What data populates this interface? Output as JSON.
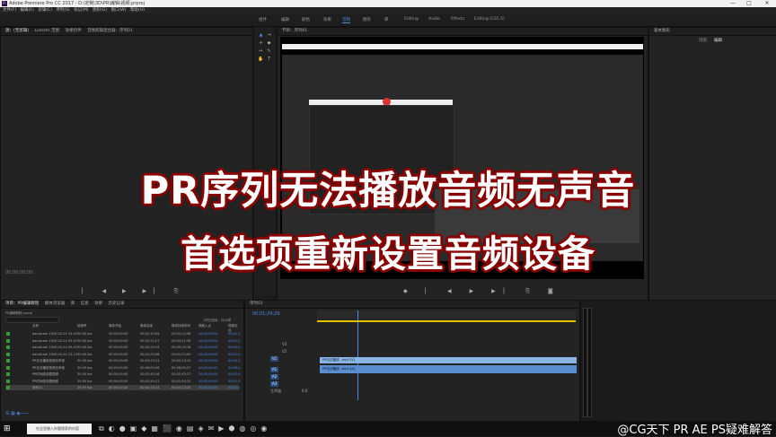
{
  "titlebar": {
    "title": "Adobe Premiere Pro CC 2017 - D:\\定制\\3D\\PR\\编辑\\视频.prproj",
    "min": "—",
    "max": "□",
    "close": "✕"
  },
  "menubar": [
    "文件(F)",
    "编辑(E)",
    "剪辑(C)",
    "序列(S)",
    "标记(M)",
    "图形(G)",
    "窗口(W)",
    "帮助(H)"
  ],
  "workspaces": [
    "组件",
    "编辑",
    "颜色",
    "效果",
    "音频",
    "图形",
    "库",
    "Editing",
    "Audio",
    "Effects",
    "Editing (CS5.5)"
  ],
  "active_workspace": "音频",
  "source_panel": {
    "tabs": [
      "源：(无剪辑)",
      "Lumetri 范围",
      "效果控件",
      "音频剪辑混合器：序列01"
    ],
    "timecode": "00;00;00;00"
  },
  "program_panel": {
    "title": "节目：序列01",
    "inner_title": "节目：序列01"
  },
  "right_panel": {
    "title": "基本图形",
    "tabs": [
      "浏览",
      "编辑"
    ]
  },
  "project_panel": {
    "tabs": [
      "项目：PR编辑教程",
      "媒体浏览器",
      "库",
      "信息",
      "效果",
      "历史记录"
    ],
    "path": "PR编辑教程.prproj",
    "item_count": "1项已选择，共28项",
    "columns": [
      "名称",
      "帧速率",
      "媒体开始",
      "媒体结束",
      "媒体持续时间",
      "视频入点",
      "视频出点"
    ],
    "rows": [
      {
        "name": "bandicam 2020-04-21 15-43",
        "fps": "30.00 fps",
        "start": "00;00;00;00",
        "end": "00;01;10;05",
        "dur": "00;01;10;06",
        "in": "00;00;00;00",
        "out": "00;01;1"
      },
      {
        "name": "bandicam 2020-04-24 09-41",
        "fps": "30.00 fps",
        "start": "00;00;00;00",
        "end": "00;02;21;27",
        "dur": "00;02;21;28",
        "in": "00;00;00;00",
        "out": "00;02;2"
      },
      {
        "name": "bandicam 2020-04-24 09-45",
        "fps": "30.00 fps",
        "start": "00;00;00;00",
        "end": "00;00;29;15",
        "dur": "00;00;29;16",
        "in": "00;00;00;00",
        "out": "00;00;2"
      },
      {
        "name": "bandicam 2020-04-24 13-14",
        "fps": "30.00 fps",
        "start": "00;00;00;00",
        "end": "00;01;23;08",
        "dur": "00;01;23;09",
        "in": "00;00;00;00",
        "out": "00;01;2"
      },
      {
        "name": "PR无法播放音频无声音",
        "fps": "30.00 fps",
        "start": "00;00;00;00",
        "end": "00;04;13;14",
        "dur": "00;04;13;15",
        "in": "00;00;00;00",
        "out": "00;04;1"
      },
      {
        "name": "PR无法播放音频无声音",
        "fps": "30.00 fps",
        "start": "00;00;00;00",
        "end": "00;06;05;06",
        "dur": "00;06;05;07",
        "in": "00;00;00;00",
        "out": "00;06;0"
      },
      {
        "name": "PR时间线设置视频",
        "fps": "30.00 fps",
        "start": "00;00;00;00",
        "end": "00;02;43;16",
        "dur": "00;02;43;17",
        "in": "00;00;00;00",
        "out": "00;02;4"
      },
      {
        "name": "PR时间线设置视频",
        "fps": "30.00 fps",
        "start": "00;00;00;00",
        "end": "00;01;50;21",
        "dur": "00;01;50;22",
        "in": "00;00;00;00",
        "out": "00;01;5"
      },
      {
        "name": "序列01",
        "fps": "29.97 fps",
        "start": "00;00;00;00",
        "end": "00;04;13;14",
        "dur": "00;04;13;15",
        "in": "00;00;00;00",
        "out": "00;04;1"
      }
    ]
  },
  "timeline": {
    "tab": "序列01",
    "timecode": "00;01;24;29",
    "video_tracks": [
      "V3",
      "V2",
      "V1"
    ],
    "audio_tracks": [
      "A1",
      "A2",
      "A3"
    ],
    "master": "主声道",
    "master_value": "0.0",
    "clip_v": "PR无法播放...mp4 [V]",
    "clip_a": "PR无法播放...mp4 [A]"
  },
  "taskbar": {
    "search_placeholder": "在这里输入你要搜索的内容"
  },
  "overlay": {
    "line1": "PR序列无法播放音频无声音",
    "line2": "首选项重新设置音频设备"
  },
  "watermark": "@CG天下 PR AE PS疑难解答",
  "colors": {
    "accent": "#4a8bea",
    "overlay_outline": "#8b0000",
    "label_green": "#3a9b3a"
  }
}
